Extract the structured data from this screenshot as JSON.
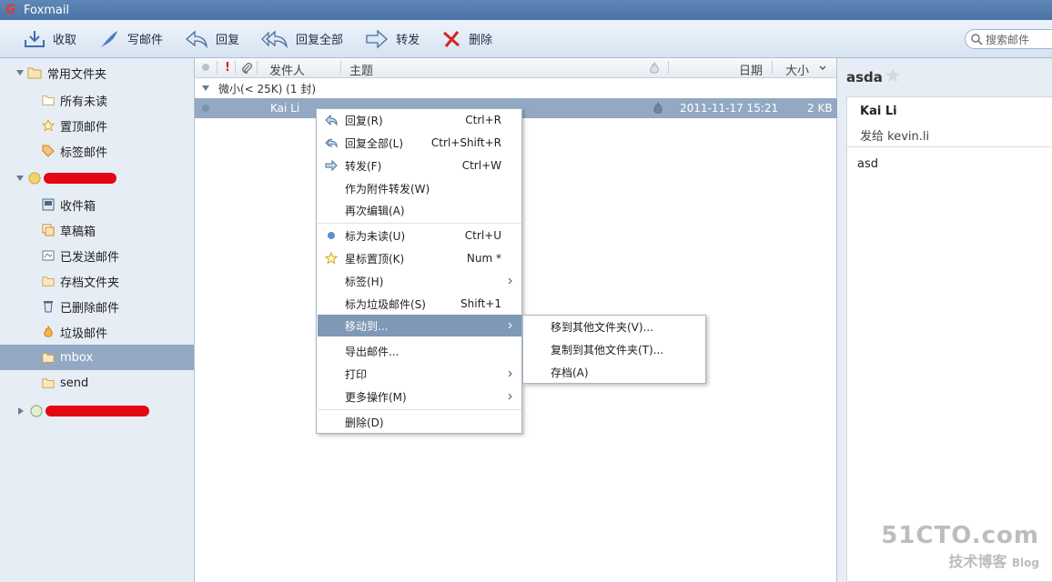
{
  "app": {
    "title": "Foxmail"
  },
  "toolbar": {
    "receive": "收取",
    "compose": "写邮件",
    "reply": "回复",
    "reply_all": "回复全部",
    "forward": "转发",
    "delete": "删除",
    "search_placeholder": "搜索邮件"
  },
  "sidebar": {
    "favorites_label": "常用文件夹",
    "favorites": [
      "所有未读",
      "置顶邮件",
      "标签邮件"
    ],
    "account_folders": [
      "收件箱",
      "草稿箱",
      "已发送邮件",
      "存档文件夹",
      "已删除邮件",
      "垃圾邮件",
      "mbox",
      "send"
    ],
    "selected_folder": "mbox"
  },
  "list": {
    "col_sender": "发件人",
    "col_subject": "主题",
    "col_date": "日期",
    "col_size": "大小",
    "group_label": "微小(< 25K) (1 封)",
    "rows": [
      {
        "sender": "Kai Li",
        "date": "2011-11-17 15:21",
        "size": "2 KB"
      }
    ]
  },
  "preview": {
    "subject": "asda",
    "from": "Kai Li",
    "to": "发给 kevin.li",
    "body": "asd"
  },
  "context_menu": {
    "items": [
      {
        "label": "回复(R)",
        "shortcut": "Ctrl+R",
        "icon": "reply-icon"
      },
      {
        "label": "回复全部(L)",
        "shortcut": "Ctrl+Shift+R",
        "icon": "reply-all-icon"
      },
      {
        "label": "转发(F)",
        "shortcut": "Ctrl+W",
        "icon": "forward-icon"
      },
      {
        "label": "作为附件转发(W)",
        "shortcut": ""
      },
      {
        "label": "再次编辑(A)",
        "shortcut": ""
      },
      {
        "label": "标为未读(U)",
        "shortcut": "Ctrl+U",
        "icon": "unread-dot-icon"
      },
      {
        "label": "星标置顶(K)",
        "shortcut": "Num *",
        "icon": "star-icon"
      },
      {
        "label": "标签(H)",
        "shortcut": ""
      },
      {
        "label": "标为垃圾邮件(S)",
        "shortcut": "Shift+1"
      },
      {
        "label": "移动到...",
        "shortcut": ""
      },
      {
        "label": "导出邮件...",
        "shortcut": ""
      },
      {
        "label": "打印",
        "shortcut": ""
      },
      {
        "label": "更多操作(M)",
        "shortcut": ""
      },
      {
        "label": "删除(D)",
        "shortcut": ""
      }
    ]
  },
  "submenu": {
    "items": [
      "移到其他文件夹(V)...",
      "复制到其他文件夹(T)...",
      "存档(A)"
    ]
  },
  "watermark": {
    "line1": "51CTO.com",
    "line2": "技术博客",
    "line3": "Blog"
  }
}
